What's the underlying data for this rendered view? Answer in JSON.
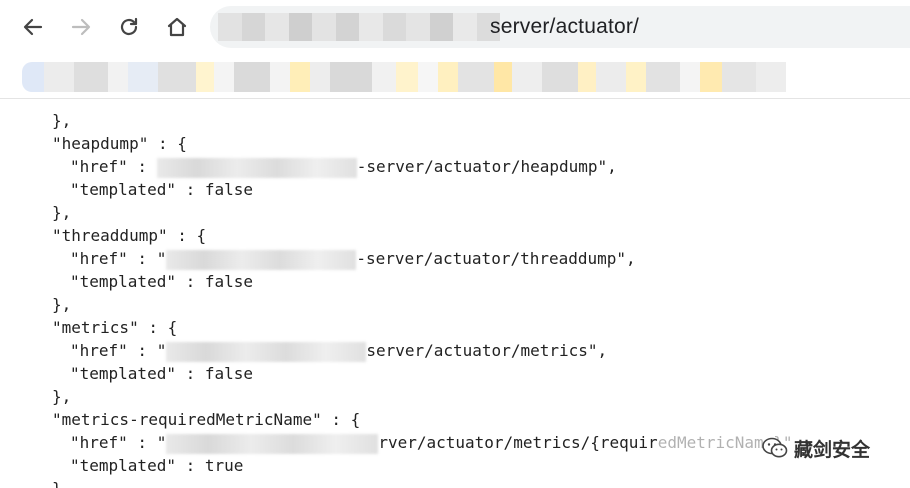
{
  "browser": {
    "url_visible": "server/actuator/",
    "nav": [
      "back",
      "forward",
      "reload",
      "home"
    ]
  },
  "json_lines": [
    {
      "indent": 0,
      "text": "},"
    },
    {
      "indent": 0,
      "text": "\"heapdump\" : {"
    },
    {
      "indent": 1,
      "text": "\"href\" : ",
      "redacted": true,
      "tail": "-server/actuator/heapdump\","
    },
    {
      "indent": 1,
      "text": "\"templated\" : false"
    },
    {
      "indent": 0,
      "text": "},"
    },
    {
      "indent": 0,
      "text": "\"threaddump\" : {"
    },
    {
      "indent": 1,
      "text": "\"href\" : \"",
      "redacted": true,
      "tail": "-server/actuator/threaddump\","
    },
    {
      "indent": 1,
      "text": "\"templated\" : false"
    },
    {
      "indent": 0,
      "text": "},"
    },
    {
      "indent": 0,
      "text": "\"metrics\" : {"
    },
    {
      "indent": 1,
      "text": "\"href\" : \"",
      "redacted": true,
      "tail": "server/actuator/metrics\","
    },
    {
      "indent": 1,
      "text": "\"templated\" : false"
    },
    {
      "indent": 0,
      "text": "},"
    },
    {
      "indent": 0,
      "text": "\"metrics-requiredMetricName\" : {"
    },
    {
      "indent": 1,
      "text": "\"href\" : \"",
      "redacted": true,
      "tail": "rver/actuator/metrics/{requir",
      "tail_hidden": "edMetricName}\","
    },
    {
      "indent": 1,
      "text": "\"templated\" : true"
    }
  ],
  "watermark": {
    "text": "藏剑安全",
    "icon": "wechat-icon"
  }
}
